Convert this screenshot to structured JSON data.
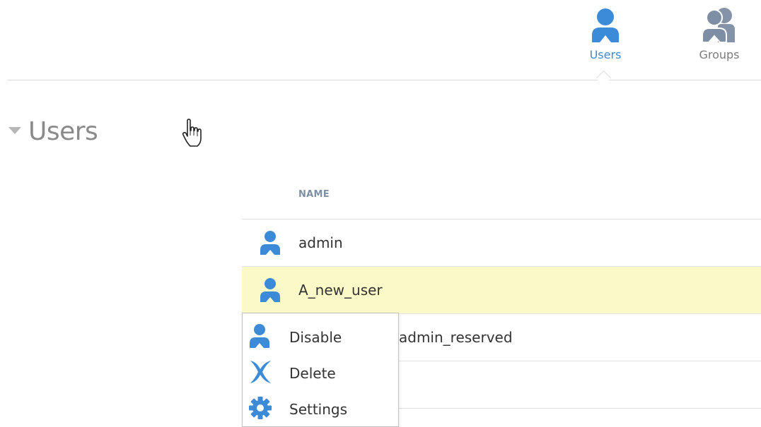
{
  "colors": {
    "accent": "#3b8bd9",
    "muted_icon": "#7e8fa5",
    "selected_row": "#fbf9c7"
  },
  "tabs": [
    {
      "label": "Users",
      "icon": "user-icon",
      "active": true
    },
    {
      "label": "Groups",
      "icon": "groups-icon",
      "active": false
    }
  ],
  "section": {
    "title": "Users",
    "toggle_icon": "caret-down-icon"
  },
  "table": {
    "columns": [
      "NAME"
    ],
    "rows": [
      {
        "name": "admin",
        "icon": "user-icon",
        "selected": false
      },
      {
        "name": "A_new_user",
        "icon": "user-icon",
        "selected": true
      },
      {
        "name": "admin_reserved",
        "icon": "user-icon",
        "selected": false
      },
      {
        "name": "",
        "icon": "",
        "selected": false
      }
    ]
  },
  "context_menu": {
    "items": [
      {
        "label": "Disable",
        "icon": "user-icon"
      },
      {
        "label": "Delete",
        "icon": "delete-x-icon"
      },
      {
        "label": "Settings",
        "icon": "gear-icon"
      }
    ]
  }
}
